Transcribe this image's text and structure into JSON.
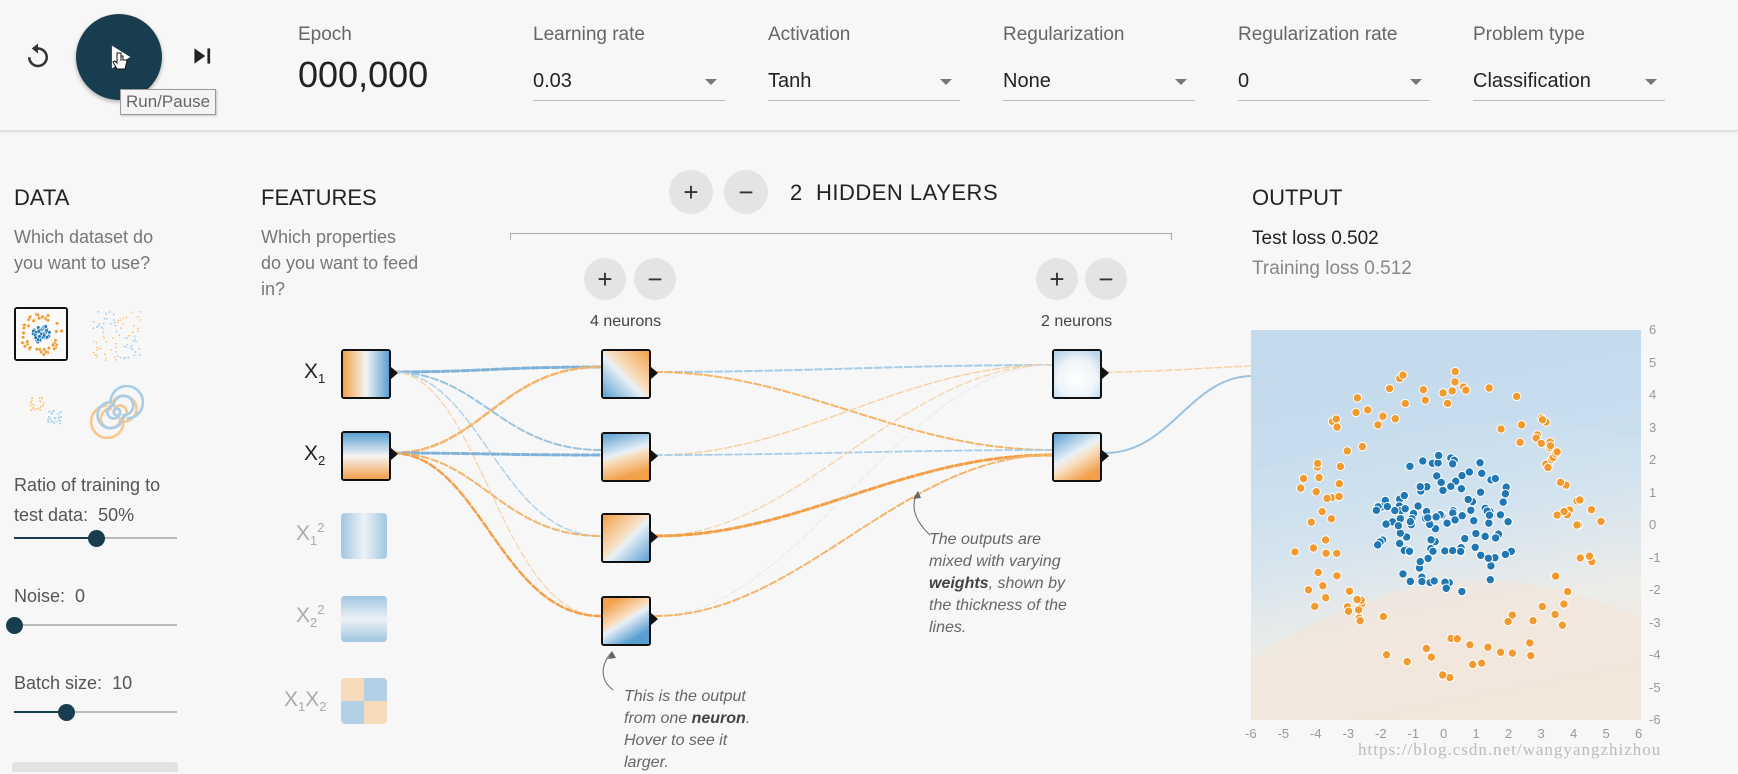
{
  "topbar": {
    "tooltip": "Run/Pause",
    "fields": {
      "epoch": {
        "label": "Epoch",
        "value": "000,000"
      },
      "learning_rate": {
        "label": "Learning rate",
        "value": "0.03"
      },
      "activation": {
        "label": "Activation",
        "value": "Tanh"
      },
      "regularization": {
        "label": "Regularization",
        "value": "None"
      },
      "regularization_rate": {
        "label": "Regularization rate",
        "value": "0"
      },
      "problem_type": {
        "label": "Problem type",
        "value": "Classification"
      }
    }
  },
  "data_panel": {
    "title": "DATA",
    "question": "Which dataset do you want to use?",
    "datasets": [
      "circle",
      "xor",
      "gaussian",
      "spiral"
    ],
    "selected_dataset": "circle",
    "ratio": {
      "label": "Ratio of training to test data:",
      "value": "50%",
      "level": 0.5
    },
    "noise": {
      "label": "Noise:",
      "value": "0",
      "level": 0
    },
    "batch": {
      "label": "Batch size:",
      "value": "10",
      "level": 0.32
    }
  },
  "features_panel": {
    "title": "FEATURES",
    "question": "Which properties do you want to feed in?",
    "features": [
      {
        "base": "X",
        "sub": "1",
        "sup": "",
        "active": true
      },
      {
        "base": "X",
        "sub": "2",
        "sup": "",
        "active": true
      },
      {
        "base": "X",
        "sub": "1",
        "sup": "2",
        "active": false
      },
      {
        "base": "X",
        "sub": "2",
        "sup": "2",
        "active": false
      },
      {
        "base": "X",
        "sub": "1",
        "sup": "",
        "base2": "X",
        "sub2": "2",
        "active": false
      }
    ]
  },
  "network": {
    "layer_count": "2",
    "hidden_label": "HIDDEN LAYERS",
    "layers": [
      {
        "neurons_label": "4 neurons"
      },
      {
        "neurons_label": "2 neurons"
      }
    ],
    "annotation_neuron": {
      "prefix": "This is the output from one ",
      "bold": "neuron",
      "suffix": ". Hover to see it larger."
    },
    "annotation_weights": {
      "prefix": "The outputs are mixed with varying ",
      "bold": "weights",
      "suffix": ", shown by the thickness of the lines."
    }
  },
  "output_panel": {
    "title": "OUTPUT",
    "test_loss": "Test loss 0.502",
    "training_loss": "Training loss 0.512",
    "x_ticks": [
      "-6",
      "-5",
      "-4",
      "-3",
      "-2",
      "-1",
      "0",
      "1",
      "2",
      "3",
      "4",
      "5",
      "6"
    ],
    "y_ticks": [
      "6",
      "5",
      "4",
      "3",
      "2",
      "1",
      "0",
      "-1",
      "-2",
      "-3",
      "-4",
      "-5",
      "-6"
    ]
  },
  "colors": {
    "blue": "#1f77b4",
    "orange": "#f29a2e",
    "dark": "#183d4e"
  },
  "watermark": "https://blog.csdn.net/wangyangzhizhou"
}
